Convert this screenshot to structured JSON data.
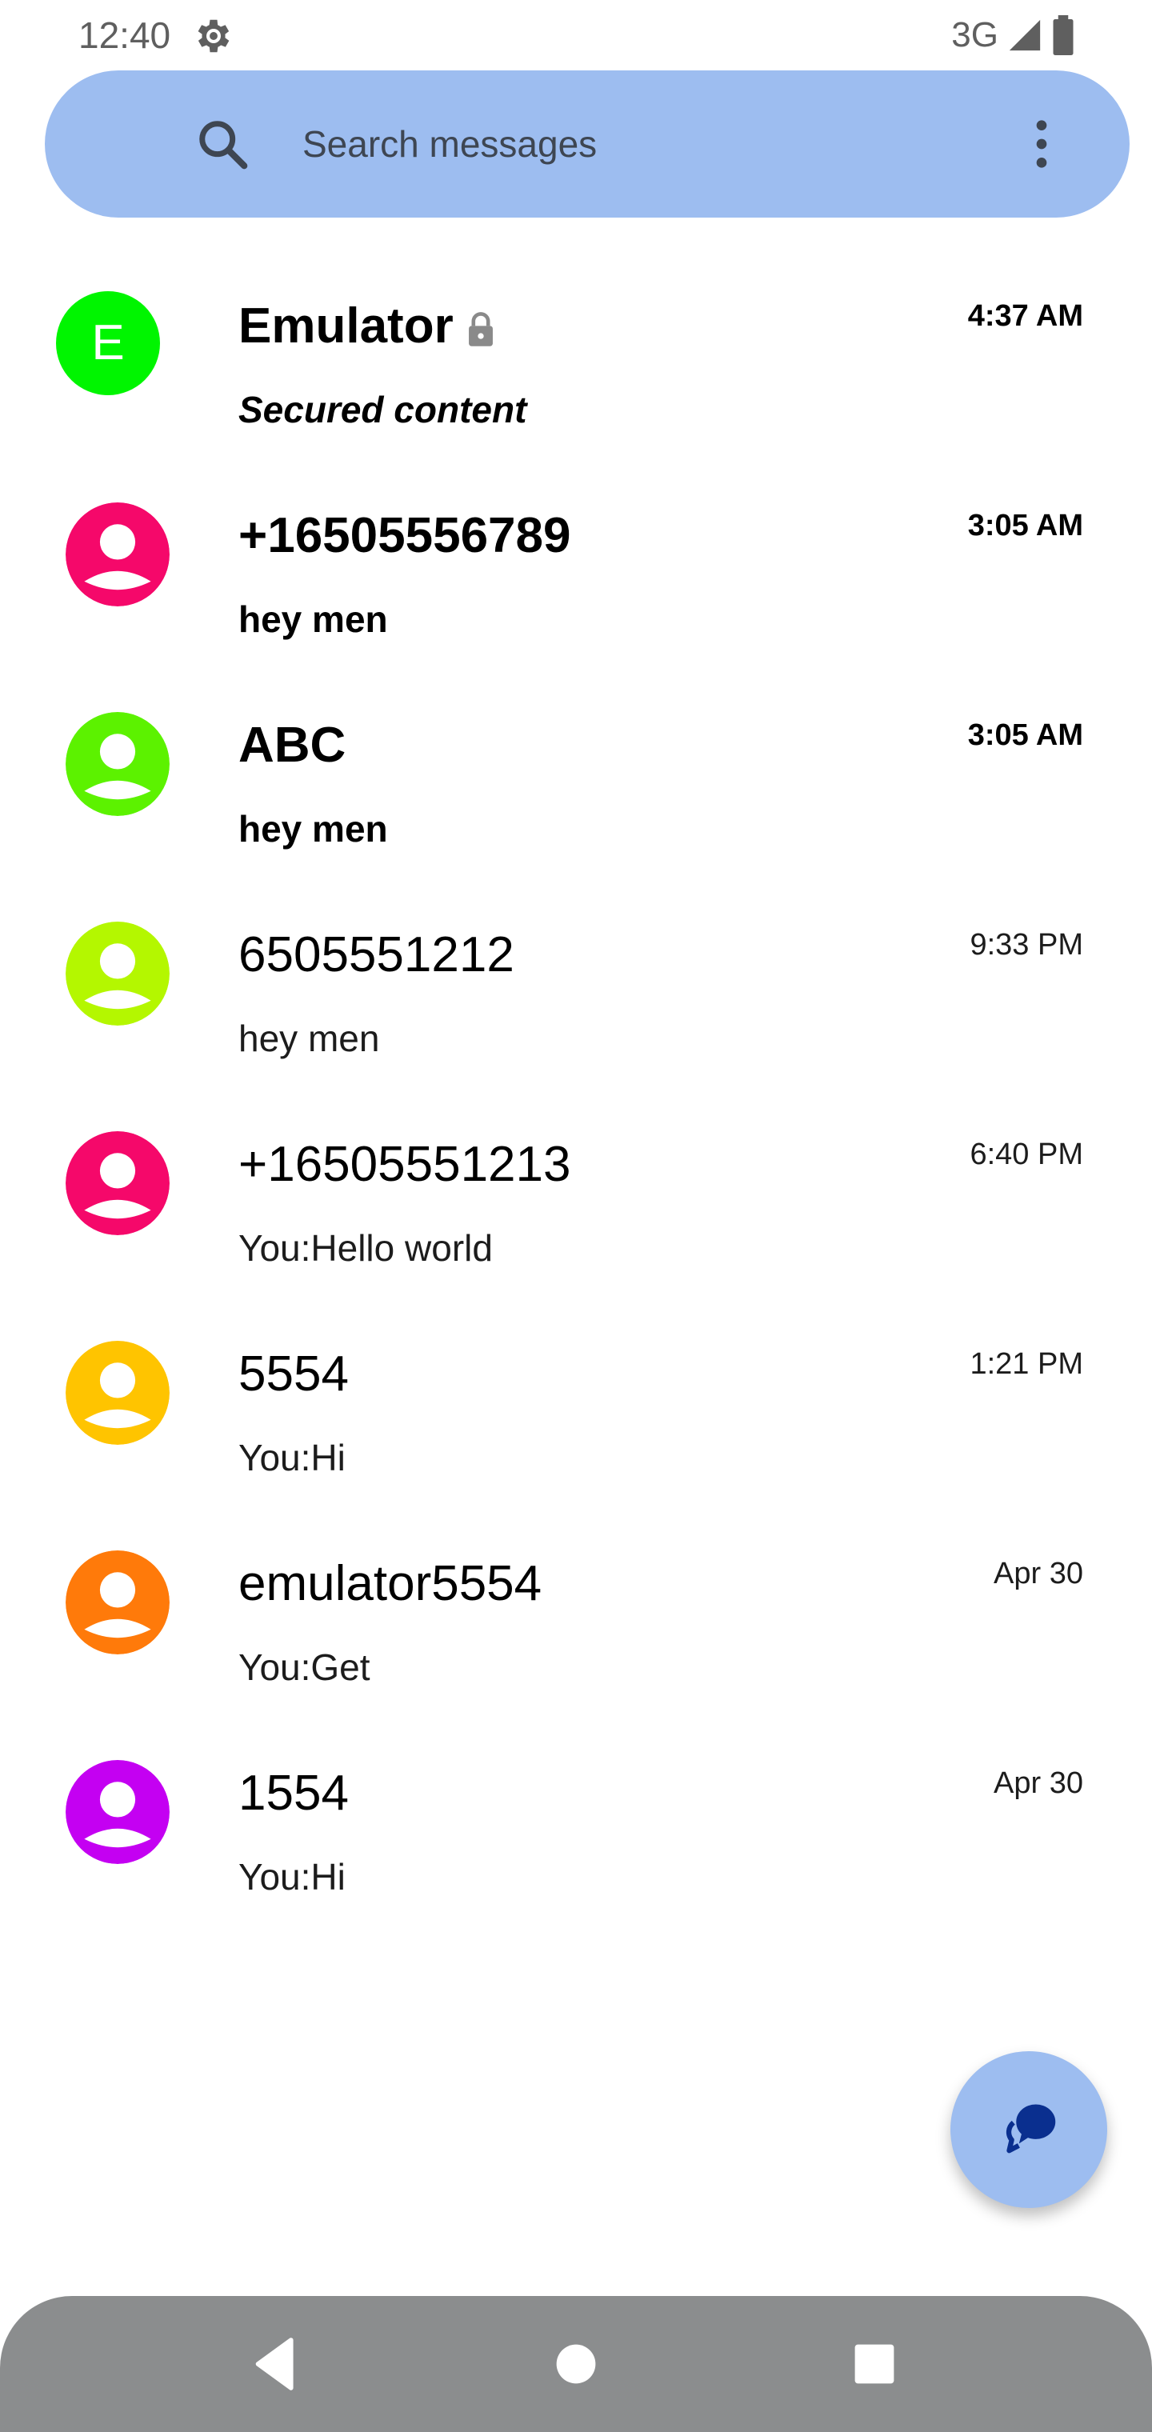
{
  "status_bar": {
    "time": "12:40",
    "network": "3G",
    "settings_icon": "gear-icon",
    "signal_icon": "signal-icon",
    "battery_icon": "battery-icon"
  },
  "search": {
    "placeholder": "Search messages",
    "search_icon": "search-icon",
    "more_icon": "more-vert-icon"
  },
  "conversations": [
    {
      "name": "Emulator",
      "snippet": "Secured content",
      "time": "4:37 AM",
      "unread": true,
      "avatar_letter": "E",
      "avatar_color": "#00f500",
      "locked": true
    },
    {
      "name": "+16505556789",
      "snippet": "hey men",
      "time": "3:05 AM",
      "unread": true,
      "avatar_color": "#f5086a"
    },
    {
      "name": "ABC",
      "snippet": "hey men",
      "time": "3:05 AM",
      "unread": true,
      "avatar_color": "#5cf200"
    },
    {
      "name": "6505551212",
      "snippet": "hey men",
      "time": "9:33 PM",
      "unread": false,
      "avatar_color": "#b4f700"
    },
    {
      "name": "+16505551213",
      "snippet": "You:Hello world",
      "time": "6:40 PM",
      "unread": false,
      "avatar_color": "#f5086a"
    },
    {
      "name": "5554",
      "snippet": "You:Hi",
      "time": "1:21 PM",
      "unread": false,
      "avatar_color": "#ffc400"
    },
    {
      "name": "emulator5554",
      "snippet": "You:Get",
      "time": "Apr 30",
      "unread": false,
      "avatar_color": "#ff7a0a"
    },
    {
      "name": "1554",
      "snippet": "You:Hi",
      "time": "Apr 30",
      "unread": false,
      "avatar_color": "#c400f2"
    }
  ],
  "fab": {
    "icon": "new-chat-icon",
    "color": "#9dbdf0"
  },
  "nav": {
    "back_icon": "back-icon",
    "home_icon": "home-icon",
    "recents_icon": "recents-icon"
  },
  "colors": {
    "accent": "#9dbdf0",
    "nav_bar": "#8b8d8e"
  }
}
